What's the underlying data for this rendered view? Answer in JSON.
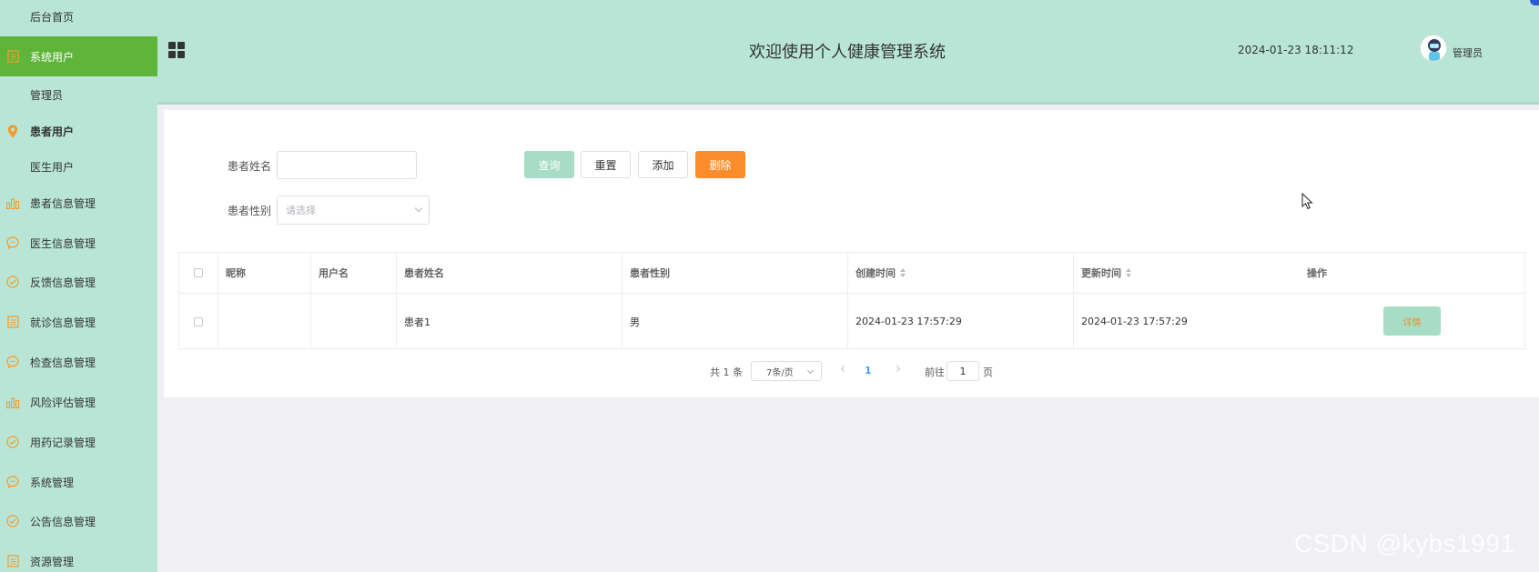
{
  "sidebar": {
    "items": [
      {
        "label": "后台首页",
        "icon": "none"
      },
      {
        "label": "系统用户",
        "icon": "document-icon",
        "active": true
      },
      {
        "label": "管理员",
        "icon": "none"
      },
      {
        "label": "患者用户",
        "icon": "map-pin-icon"
      },
      {
        "label": "医生用户",
        "icon": "none"
      },
      {
        "label": "患者信息管理",
        "icon": "bar-chart-icon"
      },
      {
        "label": "医生信息管理",
        "icon": "chat-icon"
      },
      {
        "label": "反馈信息管理",
        "icon": "check-circle-icon"
      },
      {
        "label": "就诊信息管理",
        "icon": "document-icon"
      },
      {
        "label": "检查信息管理",
        "icon": "chat-icon"
      },
      {
        "label": "风险评估管理",
        "icon": "bar-chart-icon"
      },
      {
        "label": "用药记录管理",
        "icon": "check-circle-icon"
      },
      {
        "label": "系统管理",
        "icon": "chat-icon"
      },
      {
        "label": "公告信息管理",
        "icon": "check-circle-icon"
      },
      {
        "label": "资源管理",
        "icon": "document-icon"
      }
    ]
  },
  "header": {
    "title": "欢迎使用个人健康管理系统",
    "datetime": "2024-01-23 18:11:12",
    "user": "管理员"
  },
  "search": {
    "name_label": "患者姓名",
    "name_value": "",
    "gender_label": "患者性别",
    "gender_placeholder": "请选择"
  },
  "buttons": {
    "query": "查询",
    "reset": "重置",
    "add": "添加",
    "delete": "删除"
  },
  "table": {
    "columns": [
      "昵称",
      "用户名",
      "患者姓名",
      "患者性别",
      "创建时间",
      "更新时间",
      "操作"
    ],
    "rows": [
      {
        "nickname": "",
        "username": "",
        "name": "患者1",
        "gender": "男",
        "created": "2024-01-23 17:57:29",
        "updated": "2024-01-23 17:57:29",
        "action": "详情"
      }
    ]
  },
  "pagination": {
    "total": "共 1 条",
    "page_size": "7条/页",
    "current": "1",
    "goto_label": "前往",
    "goto_value": "1",
    "page_suffix": "页"
  },
  "watermark": "CSDN @kybs1991",
  "colors": {
    "sidebar_bg": "#b9e5d6",
    "active": "#5fb53a",
    "icon_orange": "#f39c2c",
    "delete": "#fa8c2c",
    "query": "#a7dcc7"
  }
}
